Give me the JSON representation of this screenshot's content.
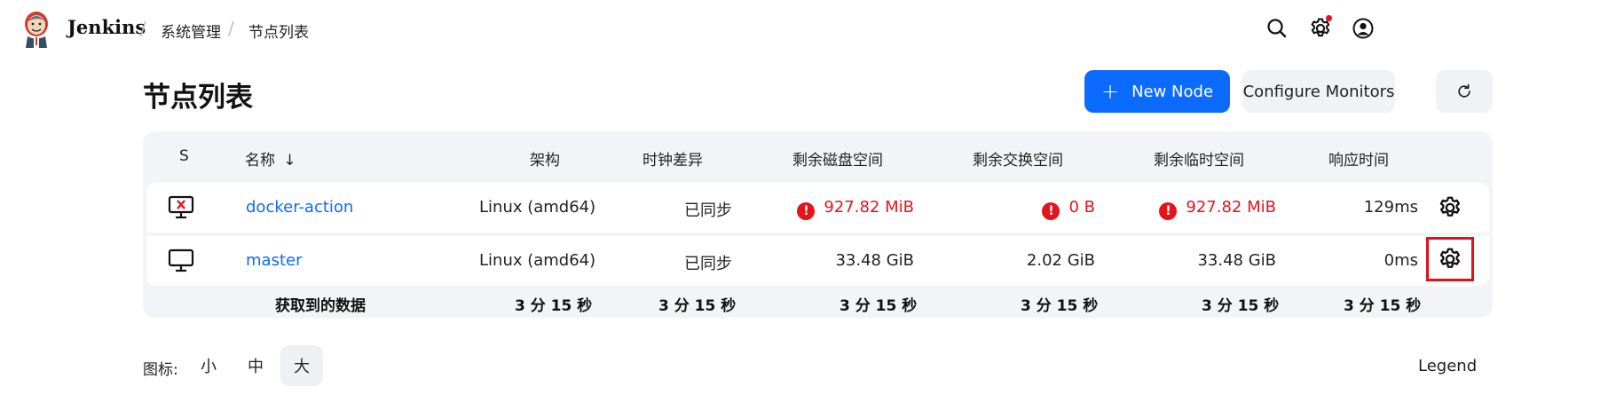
{
  "header": {
    "brand": "Jenkins",
    "breadcrumbs": [
      "系统管理",
      "节点列表"
    ],
    "breadcrumb_separator": "/"
  },
  "page": {
    "title": "节点列表",
    "new_node_label": "New Node",
    "configure_monitors_label": "Configure Monitors"
  },
  "table": {
    "headers": {
      "status": "S",
      "name": "名称",
      "sort_indicator": "↓",
      "arch": "架构",
      "clock": "时钟差异",
      "disk": "剩余磁盘空间",
      "swap": "剩余交换空间",
      "temp": "剩余临时空间",
      "response": "响应时间"
    },
    "rows": [
      {
        "name": "docker-action",
        "arch": "Linux (amd64)",
        "clock": "已同步",
        "disk": "927.82 MiB",
        "swap": "0 B",
        "temp": "927.82 MiB",
        "response": "129ms",
        "status_icon": "computer-offline-icon"
      },
      {
        "name": "master",
        "arch": "Linux (amd64)",
        "clock": "已同步",
        "disk": "33.48 GiB",
        "swap": "2.02 GiB",
        "temp": "33.48 GiB",
        "response": "0ms",
        "status_icon": "computer-icon"
      }
    ],
    "footer": {
      "label": "获取到的数据",
      "values": [
        "3 分 15 秒",
        "3 分 15 秒",
        "3 分 15 秒",
        "3 分 15 秒",
        "3 分 15 秒",
        "3 分 15 秒"
      ]
    },
    "warning_glyph": "!"
  },
  "bottom": {
    "icon_size_label": "图标:",
    "sizes": [
      "小",
      "中",
      "大"
    ],
    "active_size": "大",
    "legend_label": "Legend"
  },
  "colors": {
    "accent": "#0b6bff",
    "warning": "#e6131b",
    "highlight_box": "#e00f1a"
  }
}
